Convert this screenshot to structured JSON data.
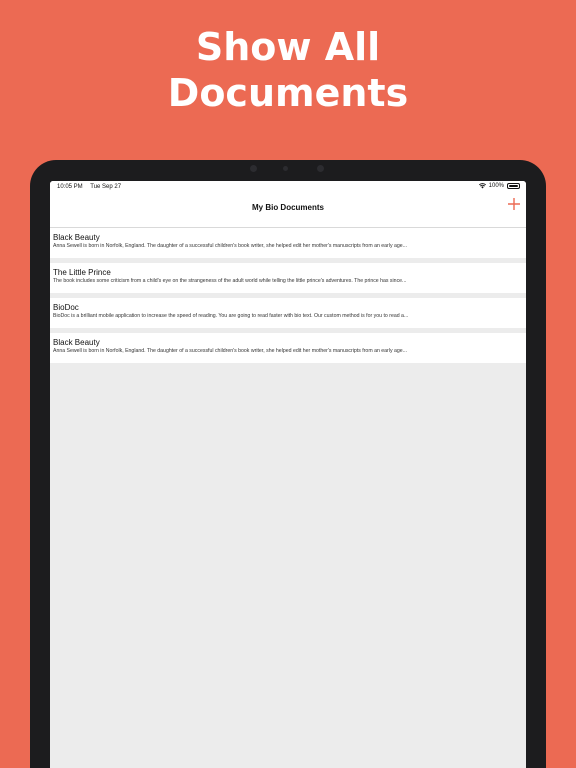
{
  "promo": {
    "headline_line1": "Show All",
    "headline_line2": "Documents"
  },
  "status_bar": {
    "time": "10:05 PM",
    "date": "Tue Sep 27",
    "battery": "100%"
  },
  "navbar": {
    "title": "My Bio Documents",
    "add_icon": "plus-icon"
  },
  "documents": [
    {
      "title": "Black Beauty",
      "description": "Anna Sewell is born in Norfolk, England. The daughter of a successful children's book writer, she helped edit her mother's manuscripts from an early age..."
    },
    {
      "title": "The Little Prince",
      "description": "The book includes some criticism from a child's eye on the strangeness of the adult world while telling the little prince's adventures. The prince has since..."
    },
    {
      "title": "BioDoc",
      "description": "BioDoc is a brilliant mobile application to increase the speed of reading. You are going to read faster with bio text. Our custom method is for you to read a..."
    },
    {
      "title": "Black Beauty",
      "description": "Anna Sewell is born in Norfolk, England. The daughter of a successful children's book writer, she helped edit her mother's manuscripts from an early age..."
    }
  ],
  "colors": {
    "background": "#ec6a53",
    "accent": "#ec6a53",
    "device_frame": "#1c1c1e",
    "list_background": "#ececec"
  }
}
